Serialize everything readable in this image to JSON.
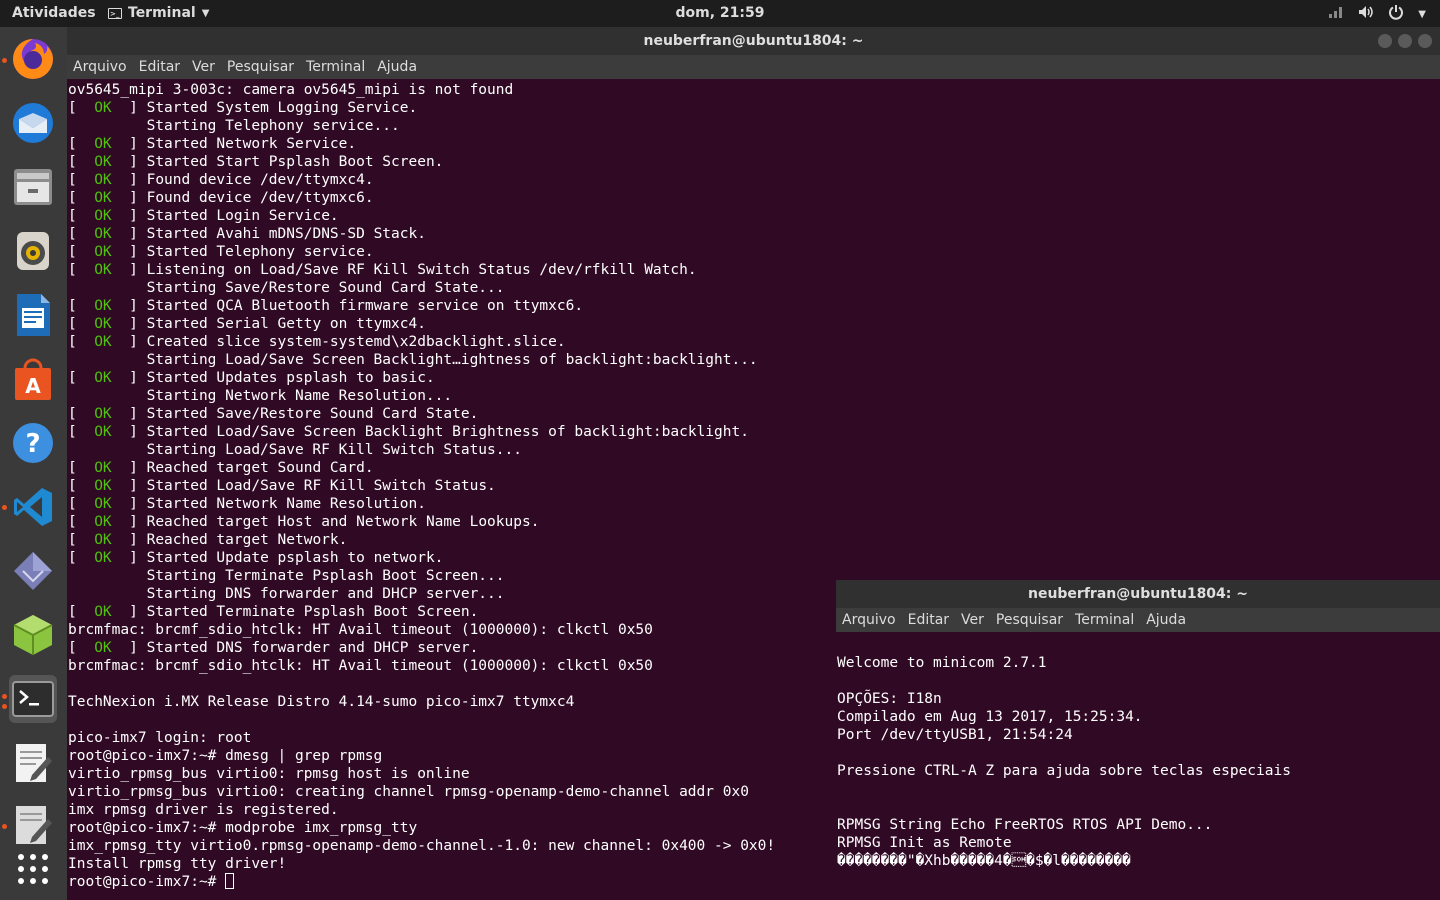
{
  "topbar": {
    "activities": "Atividades",
    "app_menu": "Terminal",
    "clock": "dom, 21:59"
  },
  "dock": {
    "items": [
      {
        "name": "firefox",
        "icon": "firefox-icon"
      },
      {
        "name": "thunderbird",
        "icon": "thunderbird-icon"
      },
      {
        "name": "files",
        "icon": "files-icon"
      },
      {
        "name": "rhythmbox",
        "icon": "speaker-icon"
      },
      {
        "name": "writer",
        "icon": "writer-icon"
      },
      {
        "name": "software",
        "icon": "shopping-bag-icon"
      },
      {
        "name": "help",
        "icon": "help-icon"
      },
      {
        "name": "vscode",
        "icon": "vscode-icon"
      },
      {
        "name": "app-diamond",
        "icon": "diamond-icon"
      },
      {
        "name": "app-cube",
        "icon": "cube-icon"
      },
      {
        "name": "terminal",
        "icon": "terminal-icon"
      },
      {
        "name": "text-editor",
        "icon": "text-editor-icon"
      },
      {
        "name": "text-editor-2",
        "icon": "text-editor-icon"
      },
      {
        "name": "show-apps",
        "icon": "grid-icon"
      }
    ],
    "colors": {
      "accent": "#e95420"
    }
  },
  "main_window": {
    "title": "neuberfran@ubuntu1804: ~",
    "menu": [
      "Arquivo",
      "Editar",
      "Ver",
      "Pesquisar",
      "Terminal",
      "Ajuda"
    ],
    "lines": [
      {
        "text": "ov5645_mipi 3-003c: camera ov5645_mipi is not found"
      },
      {
        "ok": true,
        "text": "Started System Logging Service."
      },
      {
        "text": "         Starting Telephony service..."
      },
      {
        "ok": true,
        "text": "Started Network Service."
      },
      {
        "ok": true,
        "text": "Started Start Psplash Boot Screen."
      },
      {
        "ok": true,
        "text": "Found device /dev/ttymxc4."
      },
      {
        "ok": true,
        "text": "Found device /dev/ttymxc6."
      },
      {
        "ok": true,
        "text": "Started Login Service."
      },
      {
        "ok": true,
        "text": "Started Avahi mDNS/DNS-SD Stack."
      },
      {
        "ok": true,
        "text": "Started Telephony service."
      },
      {
        "ok": true,
        "text": "Listening on Load/Save RF Kill Switch Status /dev/rfkill Watch."
      },
      {
        "text": "         Starting Save/Restore Sound Card State..."
      },
      {
        "ok": true,
        "text": "Started QCA Bluetooth firmware service on ttymxc6."
      },
      {
        "ok": true,
        "text": "Started Serial Getty on ttymxc4."
      },
      {
        "ok": true,
        "text": "Created slice system-systemd\\x2dbacklight.slice."
      },
      {
        "text": "         Starting Load/Save Screen Backlight…ightness of backlight:backlight..."
      },
      {
        "ok": true,
        "text": "Started Updates psplash to basic."
      },
      {
        "text": "         Starting Network Name Resolution..."
      },
      {
        "ok": true,
        "text": "Started Save/Restore Sound Card State."
      },
      {
        "ok": true,
        "text": "Started Load/Save Screen Backlight Brightness of backlight:backlight."
      },
      {
        "text": "         Starting Load/Save RF Kill Switch Status..."
      },
      {
        "ok": true,
        "text": "Reached target Sound Card."
      },
      {
        "ok": true,
        "text": "Started Load/Save RF Kill Switch Status."
      },
      {
        "ok": true,
        "text": "Started Network Name Resolution."
      },
      {
        "ok": true,
        "text": "Reached target Host and Network Name Lookups."
      },
      {
        "ok": true,
        "text": "Reached target Network."
      },
      {
        "ok": true,
        "text": "Started Update psplash to network."
      },
      {
        "text": "         Starting Terminate Psplash Boot Screen..."
      },
      {
        "text": "         Starting DNS forwarder and DHCP server..."
      },
      {
        "ok": true,
        "text": "Started Terminate Psplash Boot Screen."
      },
      {
        "text": "brcmfmac: brcmf_sdio_htclk: HT Avail timeout (1000000): clkctl 0x50"
      },
      {
        "ok": true,
        "text": "Started DNS forwarder and DHCP server."
      },
      {
        "text": "brcmfmac: brcmf_sdio_htclk: HT Avail timeout (1000000): clkctl 0x50"
      },
      {
        "text": ""
      },
      {
        "text": "TechNexion i.MX Release Distro 4.14-sumo pico-imx7 ttymxc4"
      },
      {
        "text": ""
      },
      {
        "text": "pico-imx7 login: root"
      },
      {
        "text": "root@pico-imx7:~# dmesg | grep rpmsg"
      },
      {
        "text": "virtio_rpmsg_bus virtio0: rpmsg host is online"
      },
      {
        "text": "virtio_rpmsg_bus virtio0: creating channel rpmsg-openamp-demo-channel addr 0x0"
      },
      {
        "text": "imx rpmsg driver is registered."
      },
      {
        "text": "root@pico-imx7:~# modprobe imx_rpmsg_tty"
      },
      {
        "text": "imx_rpmsg_tty virtio0.rpmsg-openamp-demo-channel.-1.0: new channel: 0x400 -> 0x0!"
      },
      {
        "text": "Install rpmsg tty driver!"
      },
      {
        "text": "root@pico-imx7:~# ",
        "cursor": true
      }
    ],
    "ok_label": "OK",
    "colors": {
      "background": "#300a24",
      "ok": "#4ec20d"
    }
  },
  "minicom_window": {
    "title": "neuberfran@ubuntu1804: ~",
    "menu": [
      "Arquivo",
      "Editar",
      "Ver",
      "Pesquisar",
      "Terminal",
      "Ajuda"
    ],
    "lines": [
      "Welcome to minicom 2.7.1",
      "",
      "OPÇÕES: I18n",
      "Compilado em Aug 13 2017, 15:25:34.",
      "Port /dev/ttyUSB1, 21:54:24",
      "",
      "Pressione CTRL-A Z para ajuda sobre teclas especiais",
      "",
      "",
      "RPMSG String Echo FreeRTOS RTOS API Demo...",
      "RPMSG Init as Remote",
      "��������\"�Xhb�����4�\u0001�$�l��������"
    ]
  }
}
